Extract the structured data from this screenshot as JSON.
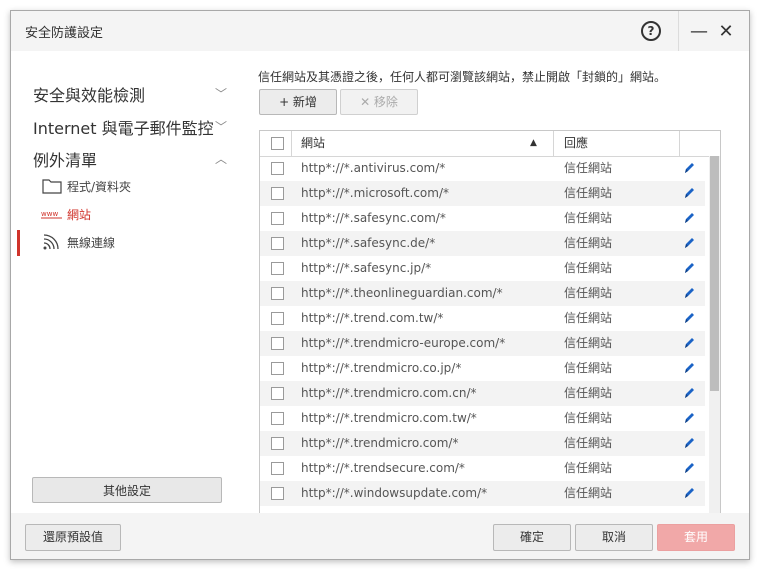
{
  "window": {
    "title": "安全防護設定"
  },
  "sidebar": {
    "nav": [
      {
        "label": "安全與效能檢測"
      },
      {
        "label": "Internet 與電子郵件監控"
      },
      {
        "label": "例外清單"
      }
    ],
    "sub_items": [
      {
        "label": "程式/資料夾",
        "icon": "folder-icon"
      },
      {
        "label": "網站",
        "icon": "www-icon"
      },
      {
        "label": "無線連線",
        "icon": "wifi-icon"
      }
    ],
    "other_settings_label": "其他設定"
  },
  "content": {
    "description": "信任網站及其憑證之後，任何人都可瀏覽該網站，禁止開啟「封鎖的」網站。",
    "add_label": "+ 新增",
    "remove_label": "✕ 移除",
    "table": {
      "col_site": "網站",
      "col_response": "回應",
      "rows": [
        {
          "url": "http*://*.antivirus.com/*",
          "response": "信任網站"
        },
        {
          "url": "http*://*.microsoft.com/*",
          "response": "信任網站"
        },
        {
          "url": "http*://*.safesync.com/*",
          "response": "信任網站"
        },
        {
          "url": "http*://*.safesync.de/*",
          "response": "信任網站"
        },
        {
          "url": "http*://*.safesync.jp/*",
          "response": "信任網站"
        },
        {
          "url": "http*://*.theonlineguardian.com/*",
          "response": "信任網站"
        },
        {
          "url": "http*://*.trend.com.tw/*",
          "response": "信任網站"
        },
        {
          "url": "http*://*.trendmicro-europe.com/*",
          "response": "信任網站"
        },
        {
          "url": "http*://*.trendmicro.co.jp/*",
          "response": "信任網站"
        },
        {
          "url": "http*://*.trendmicro.com.cn/*",
          "response": "信任網站"
        },
        {
          "url": "http*://*.trendmicro.com.tw/*",
          "response": "信任網站"
        },
        {
          "url": "http*://*.trendmicro.com/*",
          "response": "信任網站"
        },
        {
          "url": "http*://*.trendsecure.com/*",
          "response": "信任網站"
        },
        {
          "url": "http*://*.windowsupdate.com/*",
          "response": "信任網站"
        }
      ]
    }
  },
  "footer": {
    "restore_label": "還原預設值",
    "ok_label": "確定",
    "cancel_label": "取消",
    "apply_label": "套用"
  },
  "colors": {
    "accent_red": "#d0342c",
    "edit_blue": "#1a63c6",
    "apply_disabled": "#f1a8a8"
  }
}
